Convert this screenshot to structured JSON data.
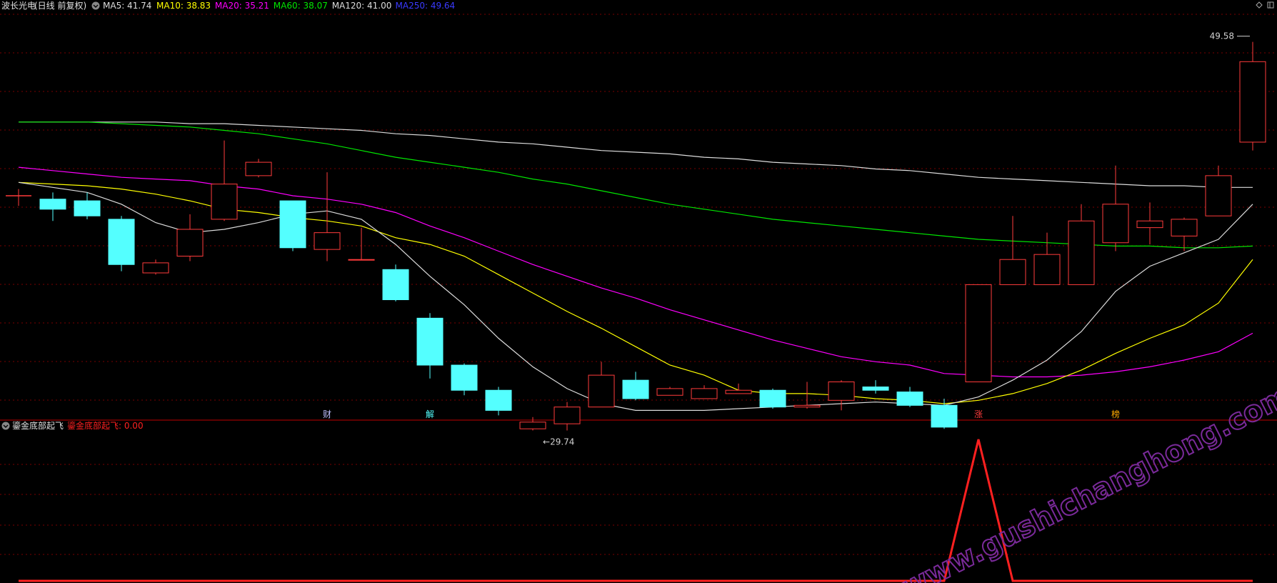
{
  "header": {
    "stock_name": "波长光电",
    "period_label": "(日线 前复权)",
    "ma_items": [
      {
        "label": "MA5: 41.74",
        "color": "#dcdcdc"
      },
      {
        "label": "MA10: 38.83",
        "color": "#ffff00"
      },
      {
        "label": "MA20: 35.21",
        "color": "#ff00ff"
      },
      {
        "label": "MA60: 38.07",
        "color": "#00e600"
      },
      {
        "label": "MA120: 41.00",
        "color": "#dcdcdc"
      },
      {
        "label": "MA250: 49.64",
        "color": "#3a3aff"
      }
    ]
  },
  "indicator": {
    "name": "鎏金底部起飞",
    "value_label": "鎏金底部起飞: 0.00",
    "color": "#ff2020"
  },
  "watermark": "www.gushichanghong.com",
  "colors": {
    "up": "#ff3b3b",
    "down": "#54ffff",
    "grid": "#7a0000",
    "separator": "#c00000",
    "ma5": "#dcdcdc",
    "ma10": "#ffff00",
    "ma20": "#ff00ff",
    "ma60": "#00e600",
    "ma120": "#dcdcdc"
  },
  "chart_data": {
    "type": "candlestick",
    "price_range": [
      28.0,
      50.8
    ],
    "annotations": {
      "high_label": "49.58",
      "low_label": "29.74"
    },
    "markers": [
      {
        "index": 9,
        "text": "财",
        "color": "#bfbfff"
      },
      {
        "index": 12,
        "text": "解",
        "color": "#54ffff"
      },
      {
        "index": 28,
        "text": "涨",
        "color": "#ff3b3b"
      },
      {
        "index": 32,
        "text": "榜",
        "color": "#ffaa00"
      }
    ],
    "candles": [
      {
        "o": 40.4,
        "h": 40.8,
        "l": 39.8,
        "c": 40.4
      },
      {
        "o": 40.2,
        "h": 40.6,
        "l": 38.9,
        "c": 39.6
      },
      {
        "o": 40.1,
        "h": 40.6,
        "l": 39.0,
        "c": 39.2
      },
      {
        "o": 39.0,
        "h": 39.2,
        "l": 35.9,
        "c": 36.3
      },
      {
        "o": 35.8,
        "h": 36.6,
        "l": 35.7,
        "c": 36.4
      },
      {
        "o": 36.8,
        "h": 39.3,
        "l": 36.5,
        "c": 38.4
      },
      {
        "o": 39.0,
        "h": 43.7,
        "l": 38.9,
        "c": 41.1
      },
      {
        "o": 41.6,
        "h": 42.6,
        "l": 41.5,
        "c": 42.4
      },
      {
        "o": 40.1,
        "h": 40.1,
        "l": 37.1,
        "c": 37.3
      },
      {
        "o": 37.2,
        "h": 41.8,
        "l": 36.5,
        "c": 38.2
      },
      {
        "o": 36.6,
        "h": 38.5,
        "l": 36.6,
        "c": 36.6
      },
      {
        "o": 36.0,
        "h": 36.3,
        "l": 34.1,
        "c": 34.2
      },
      {
        "o": 33.1,
        "h": 33.4,
        "l": 29.5,
        "c": 30.3
      },
      {
        "o": 30.3,
        "h": 30.4,
        "l": 28.5,
        "c": 28.8
      },
      {
        "o": 28.8,
        "h": 29.0,
        "l": 27.3,
        "c": 27.6
      },
      {
        "o": 26.5,
        "h": 27.2,
        "l": 26.4,
        "c": 26.9
      },
      {
        "o": 26.8,
        "h": 28.1,
        "l": 26.4,
        "c": 27.8
      },
      {
        "o": 27.8,
        "h": 30.5,
        "l": 27.8,
        "c": 29.7
      },
      {
        "o": 29.4,
        "h": 29.9,
        "l": 28.2,
        "c": 28.3
      },
      {
        "o": 28.5,
        "h": 29.0,
        "l": 28.5,
        "c": 28.9
      },
      {
        "o": 28.3,
        "h": 29.1,
        "l": 28.3,
        "c": 28.9
      },
      {
        "o": 28.6,
        "h": 29.2,
        "l": 28.6,
        "c": 28.8
      },
      {
        "o": 28.8,
        "h": 28.9,
        "l": 27.7,
        "c": 27.8
      },
      {
        "o": 27.8,
        "h": 29.3,
        "l": 27.7,
        "c": 27.9
      },
      {
        "o": 28.2,
        "h": 29.4,
        "l": 27.6,
        "c": 29.3
      },
      {
        "o": 29.0,
        "h": 29.4,
        "l": 28.6,
        "c": 28.8
      },
      {
        "o": 28.7,
        "h": 29.0,
        "l": 27.8,
        "c": 27.9
      },
      {
        "o": 27.9,
        "h": 28.3,
        "l": 26.5,
        "c": 26.6
      },
      {
        "o": 29.3,
        "h": 35.1,
        "l": 29.3,
        "c": 35.1
      },
      {
        "o": 35.1,
        "h": 39.2,
        "l": 35.1,
        "c": 36.6
      },
      {
        "o": 35.1,
        "h": 38.2,
        "l": 35.1,
        "c": 36.9
      },
      {
        "o": 35.1,
        "h": 39.9,
        "l": 35.1,
        "c": 38.9
      },
      {
        "o": 37.6,
        "h": 42.2,
        "l": 37.1,
        "c": 39.9
      },
      {
        "o": 38.5,
        "h": 40.0,
        "l": 37.5,
        "c": 38.9
      },
      {
        "o": 38.0,
        "h": 39.1,
        "l": 37.1,
        "c": 39.0
      },
      {
        "o": 39.2,
        "h": 42.2,
        "l": 39.2,
        "c": 41.6
      },
      {
        "o": 43.6,
        "h": 49.58,
        "l": 43.1,
        "c": 48.4
      }
    ],
    "ma5": [
      41.2,
      40.9,
      40.6,
      39.9,
      38.8,
      38.2,
      38.4,
      38.8,
      39.3,
      39.5,
      39.0,
      37.5,
      35.6,
      33.9,
      31.9,
      30.2,
      28.9,
      28.0,
      27.6,
      27.6,
      27.6,
      27.7,
      27.8,
      27.9,
      28.0,
      28.1,
      28.0,
      27.9,
      28.4,
      29.4,
      30.6,
      32.3,
      34.7,
      36.2,
      37.0,
      37.8,
      39.9
    ],
    "ma10": [
      41.2,
      41.1,
      41.0,
      40.8,
      40.5,
      40.1,
      39.6,
      39.4,
      39.1,
      38.9,
      38.6,
      37.9,
      37.5,
      36.8,
      35.7,
      34.6,
      33.5,
      32.5,
      31.4,
      30.3,
      29.7,
      28.8,
      28.6,
      28.6,
      28.5,
      28.3,
      28.2,
      28.0,
      28.2,
      28.6,
      29.2,
      30.0,
      31.0,
      31.9,
      32.7,
      34.0,
      36.6
    ],
    "ma20": [
      42.1,
      41.9,
      41.7,
      41.5,
      41.4,
      41.3,
      41.0,
      40.8,
      40.4,
      40.2,
      39.9,
      39.4,
      38.6,
      37.9,
      37.1,
      36.3,
      35.6,
      34.9,
      34.3,
      33.6,
      33.0,
      32.4,
      31.8,
      31.3,
      30.8,
      30.5,
      30.3,
      29.8,
      29.7,
      29.6,
      29.6,
      29.7,
      29.9,
      30.2,
      30.6,
      31.1,
      32.2
    ],
    "ma60": [
      44.8,
      44.8,
      44.8,
      44.7,
      44.6,
      44.5,
      44.3,
      44.1,
      43.8,
      43.5,
      43.1,
      42.7,
      42.4,
      42.1,
      41.8,
      41.4,
      41.1,
      40.7,
      40.3,
      39.9,
      39.6,
      39.3,
      39.0,
      38.8,
      38.6,
      38.4,
      38.2,
      38.0,
      37.8,
      37.7,
      37.6,
      37.5,
      37.4,
      37.4,
      37.3,
      37.3,
      37.4
    ],
    "ma120": [
      44.8,
      44.8,
      44.8,
      44.8,
      44.8,
      44.7,
      44.7,
      44.6,
      44.5,
      44.4,
      44.3,
      44.1,
      44.0,
      43.8,
      43.6,
      43.5,
      43.3,
      43.1,
      43.0,
      42.9,
      42.7,
      42.6,
      42.4,
      42.3,
      42.2,
      42.0,
      41.9,
      41.7,
      41.5,
      41.4,
      41.3,
      41.2,
      41.1,
      41.0,
      41.0,
      40.9,
      40.9
    ],
    "indicator_values": [
      0,
      0,
      0,
      0,
      0,
      0,
      0,
      0,
      0,
      0,
      0,
      0,
      0,
      0,
      0,
      0,
      0,
      0,
      0,
      0,
      0,
      0,
      0,
      0,
      0,
      0,
      0,
      0,
      1,
      0,
      0,
      0,
      0,
      0,
      0,
      0,
      0
    ],
    "indicator_range": [
      0,
      1
    ]
  }
}
